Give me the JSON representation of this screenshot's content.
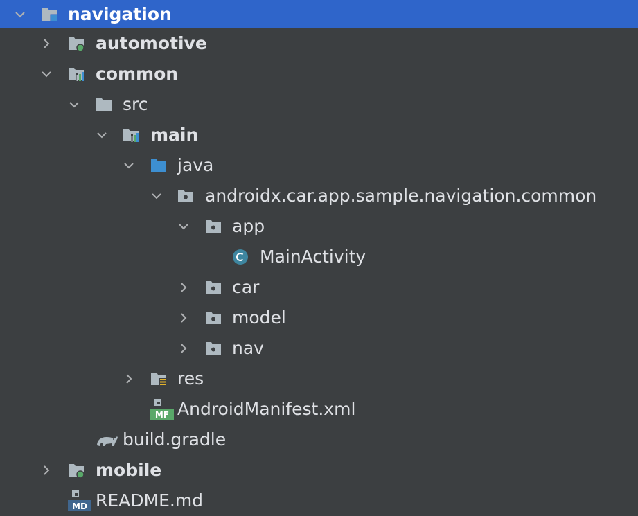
{
  "tree": [
    {
      "label": "navigation",
      "expanded": true,
      "bold": true,
      "icon": "module-folder-icon",
      "selected": true
    },
    {
      "label": "automotive",
      "expanded": false,
      "bold": true,
      "icon": "app-module-folder-icon"
    },
    {
      "label": "common",
      "expanded": true,
      "bold": true,
      "icon": "library-module-folder-icon"
    },
    {
      "label": "src",
      "expanded": true,
      "bold": false,
      "icon": "folder-icon"
    },
    {
      "label": "main",
      "expanded": true,
      "bold": true,
      "icon": "source-set-folder-icon"
    },
    {
      "label": "java",
      "expanded": true,
      "bold": false,
      "icon": "source-root-folder-icon"
    },
    {
      "label": "androidx.car.app.sample.navigation.common",
      "expanded": true,
      "bold": false,
      "icon": "package-icon"
    },
    {
      "label": "app",
      "expanded": true,
      "bold": false,
      "icon": "package-icon"
    },
    {
      "label": "MainActivity",
      "expanded": null,
      "bold": false,
      "icon": "class-icon"
    },
    {
      "label": "car",
      "expanded": false,
      "bold": false,
      "icon": "package-icon"
    },
    {
      "label": "model",
      "expanded": false,
      "bold": false,
      "icon": "package-icon"
    },
    {
      "label": "nav",
      "expanded": false,
      "bold": false,
      "icon": "package-icon"
    },
    {
      "label": "res",
      "expanded": false,
      "bold": false,
      "icon": "resources-folder-icon"
    },
    {
      "label": "AndroidManifest.xml",
      "expanded": null,
      "bold": false,
      "icon": "manifest-file-icon"
    },
    {
      "label": "build.gradle",
      "expanded": null,
      "bold": false,
      "icon": "gradle-icon"
    },
    {
      "label": "mobile",
      "expanded": false,
      "bold": true,
      "icon": "app-module-folder-icon"
    },
    {
      "label": "README.md",
      "expanded": null,
      "bold": false,
      "icon": "markdown-file-icon"
    }
  ],
  "colors": {
    "background": "#3c3f41",
    "selection": "#2f65ca",
    "text": "#dfe1e5",
    "folder": "#aeb9c0",
    "source_root": "#3d8fd1",
    "class_icon": "#3e86a0",
    "app_dot": "#59a869",
    "manifest": "#59a869",
    "markdown": "#40668e"
  }
}
